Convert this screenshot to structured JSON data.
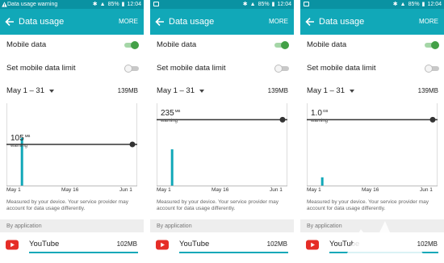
{
  "colors": {
    "status_bar": "#0a92a2",
    "app_bar": "#11a8b8",
    "usage_bar": "#11a8b8",
    "toggle_on": "#43a047",
    "warning_line": "#333333"
  },
  "screens": [
    {
      "status": {
        "left_text": "Data usage warning",
        "battery": "85%",
        "time": "12:04"
      },
      "app_bar": {
        "title": "Data usage",
        "more": "MORE"
      },
      "mobile_data": {
        "label": "Mobile data",
        "enabled": true
      },
      "limit": {
        "label": "Set mobile data limit",
        "enabled": false
      },
      "period": {
        "label": "May 1 – 31",
        "total": "139MB"
      },
      "warning": {
        "value": "105",
        "unit": "MB",
        "label": "warning",
        "level": 0.5
      },
      "chart_ticks": [
        "May 1",
        "May 16",
        "Jun 1"
      ],
      "usage_bar": {
        "day": 3,
        "height": 0.58
      },
      "footnote": "Measured by your device. Your service provider may account for data usage differently.",
      "section": "By application",
      "app": {
        "name": "YouTube",
        "size": "102MB"
      }
    },
    {
      "status": {
        "left_text": "",
        "battery": "85%",
        "time": "12:04"
      },
      "app_bar": {
        "title": "Data usage",
        "more": "MORE"
      },
      "mobile_data": {
        "label": "Mobile data",
        "enabled": true
      },
      "limit": {
        "label": "Set mobile data limit",
        "enabled": false
      },
      "period": {
        "label": "May 1 – 31",
        "total": "139MB"
      },
      "warning": {
        "value": "235",
        "unit": "MB",
        "label": "warning",
        "level": 0.8
      },
      "chart_ticks": [
        "May 1",
        "May 16",
        "Jun 1"
      ],
      "usage_bar": {
        "day": 3,
        "height": 0.44
      },
      "footnote": "Measured by your device. Your service provider may account for data usage differently.",
      "section": "By application",
      "app": {
        "name": "YouTube",
        "size": "102MB"
      }
    },
    {
      "status": {
        "left_text": "",
        "battery": "85%",
        "time": "12:04"
      },
      "app_bar": {
        "title": "Data usage",
        "more": "MORE"
      },
      "mobile_data": {
        "label": "Mobile data",
        "enabled": true
      },
      "limit": {
        "label": "Set mobile data limit",
        "enabled": false
      },
      "period": {
        "label": "May 1 – 31",
        "total": "139MB"
      },
      "warning": {
        "value": "1.0",
        "unit": "GB",
        "label": "warning",
        "level": 0.8
      },
      "chart_ticks": [
        "May 1",
        "May 16",
        "Jun 1"
      ],
      "usage_bar": {
        "day": 3,
        "height": 0.1
      },
      "footnote": "Measured by your device. Your service provider may account for data usage differently.",
      "section": "By application",
      "app": {
        "name": "YouTube",
        "size": "102MB"
      }
    }
  ]
}
